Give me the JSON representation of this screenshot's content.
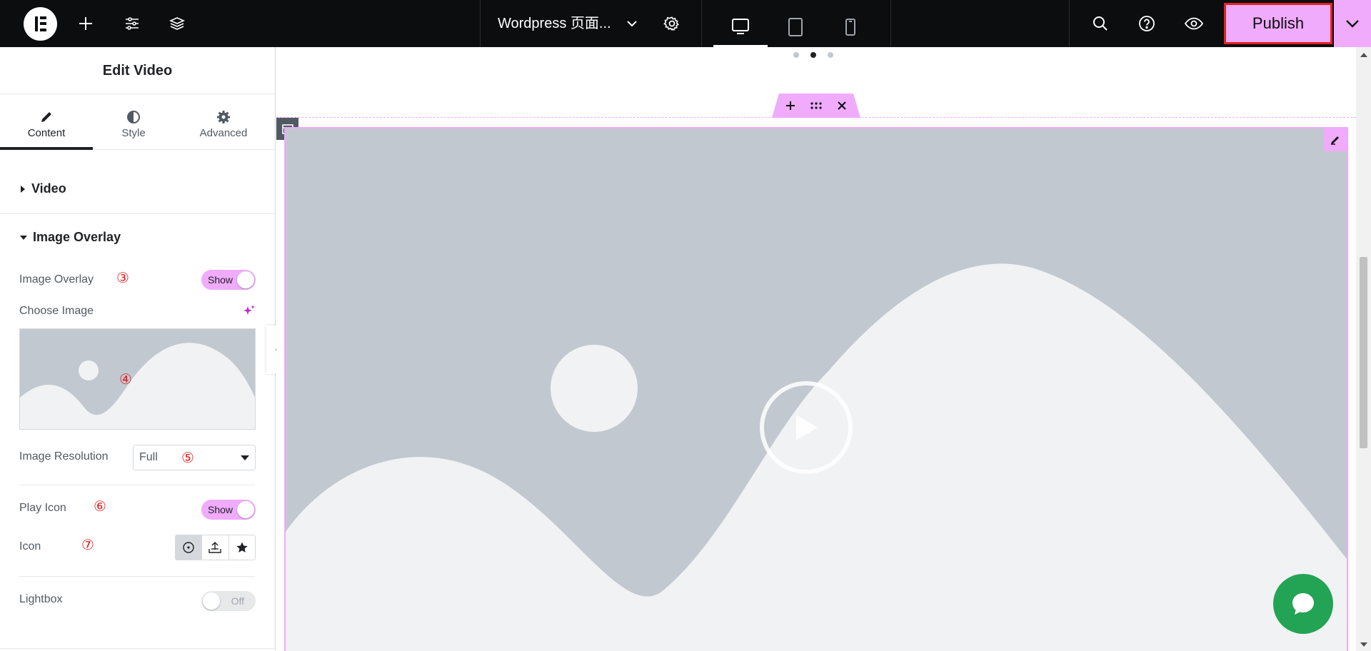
{
  "topbar": {
    "document_title": "Wordpress 页面...",
    "publish_label": "Publish"
  },
  "panel": {
    "title": "Edit Video",
    "tabs": [
      {
        "label": "Content"
      },
      {
        "label": "Style"
      },
      {
        "label": "Advanced"
      }
    ],
    "sections": {
      "video": "Video",
      "image_overlay": "Image Overlay"
    },
    "fields": {
      "image_overlay_label": "Image Overlay",
      "image_overlay_state": "Show",
      "choose_image_label": "Choose Image",
      "image_resolution_label": "Image Resolution",
      "image_resolution_value": "Full",
      "play_icon_label": "Play Icon",
      "play_icon_state": "Show",
      "icon_label": "Icon",
      "lightbox_label": "Lightbox",
      "lightbox_state": "Off"
    },
    "markers": {
      "m3": "③",
      "m4": "④",
      "m5": "⑤",
      "m6": "⑥",
      "m7": "⑦"
    }
  },
  "colors": {
    "accent": "#f0abfc",
    "topbar": "#0c0d0e",
    "publish_highlight": "#e22222",
    "placeholder_gray": "#c2c8d0",
    "chat": "#23a455"
  }
}
